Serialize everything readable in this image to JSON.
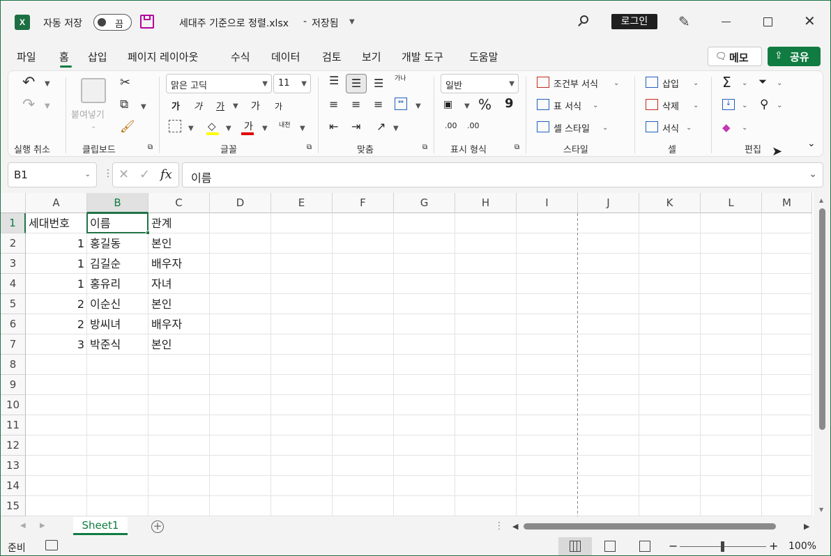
{
  "title": {
    "autosave_label": "자동 저장",
    "autosave_state": "끔",
    "filename": "세대주 기준으로 정렬.xlsx",
    "separator": "-",
    "saved_state": "저장됨",
    "login": "로그인"
  },
  "tabs": [
    "파일",
    "홈",
    "삽입",
    "페이지 레이아웃",
    "수식",
    "데이터",
    "검토",
    "보기",
    "개발 도구",
    "도움말"
  ],
  "active_tab": "홈",
  "actions": {
    "memo": "메모",
    "share": "공유"
  },
  "ribbon": {
    "undo_group": "실행 취소",
    "clipboard_group": "클립보드",
    "paste_label": "붙여넣기",
    "font_group": "글꼴",
    "font_name": "맑은 고딕",
    "font_size": "11",
    "bold": "가",
    "italic": "가",
    "underline": "가",
    "grow": "가",
    "shrink": "가",
    "font_color_glyph": "가",
    "phonetic": "내천",
    "alignment_group": "맞춤",
    "wrap_glyph": "가나",
    "number_group": "표시 형식",
    "number_format": "일반",
    "percent": "%",
    "comma": "9",
    "dec_inc": ".00",
    "dec_dec": ".00",
    "styles_group": "스타일",
    "conditional": "조건부 서식",
    "table_format": "표 서식",
    "cell_style": "셀 스타일",
    "cells_group": "셀",
    "insert": "삽입",
    "delete": "삭제",
    "format": "서식",
    "editing_group": "편집"
  },
  "formula_bar": {
    "name_box": "B1",
    "fx": "fx",
    "value": "이름"
  },
  "columns": [
    "A",
    "B",
    "C",
    "D",
    "E",
    "F",
    "G",
    "H",
    "I",
    "J",
    "K",
    "L",
    "M"
  ],
  "rows": [
    "1",
    "2",
    "3",
    "4",
    "5",
    "6",
    "7",
    "8",
    "9",
    "10",
    "11",
    "12",
    "13",
    "14",
    "15"
  ],
  "cells": [
    [
      "세대번호",
      "이름",
      "관계"
    ],
    [
      "1",
      "홍길동",
      "본인"
    ],
    [
      "1",
      "김길순",
      "배우자"
    ],
    [
      "1",
      "홍유리",
      "자녀"
    ],
    [
      "2",
      "이순신",
      "본인"
    ],
    [
      "2",
      "방씨녀",
      "배우자"
    ],
    [
      "3",
      "박준식",
      "본인"
    ]
  ],
  "sheet_tab": "Sheet1",
  "status": {
    "ready": "준비",
    "zoom": "100%"
  },
  "colors": {
    "excel_green": "#107c41",
    "accent": "#0f6e3a",
    "selection": "#217346"
  }
}
